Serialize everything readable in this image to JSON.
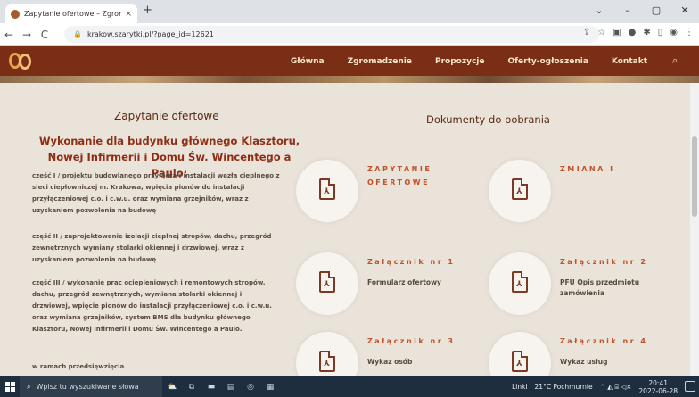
{
  "browser": {
    "tab_title": "Zapytanie ofertowe – Zgromadz",
    "tab_close": "×",
    "new_tab": "+",
    "url": "krakow.szarytki.pl/?page_id=12621",
    "window_controls": [
      "⌄",
      "–",
      "▢",
      "✕"
    ],
    "nav": {
      "back": "←",
      "forward": "→",
      "reload": "C"
    },
    "toolbar_icons": [
      "share-icon",
      "star-icon",
      "extension-icon",
      "profile-icon",
      "puzzle-icon",
      "sidebar-icon",
      "account-icon",
      "menu-icon"
    ]
  },
  "site": {
    "menu": [
      "Główna",
      "Zgromadzenie",
      "Propozycje",
      "Oferty-ogłoszenia",
      "Kontakt"
    ]
  },
  "left": {
    "title": "Zapytanie ofertowe",
    "subtitle": "Wykonanie dla budynku głównego Klasztoru, Nowej Infirmerii i Domu Św. Wincentego a Paulo:",
    "paragraphs": [
      "cześć I / projektu budowlanego przyłącza i instalacji węzła cieplnego z sieci ciepłowniczej m. Krakowa, wpięcia pionów do instalacji przyłączeniowej c.o. i c.w.u. oraz wymiana grzejników, wraz z uzyskaniem pozwolenia na budowę",
      "część II / zaprojektowanie izolacji cieplnej stropów, dachu, przegród zewnętrznych wymiany stolarki okiennej i drzwiowej, wraz z uzyskaniem pozwolenia na budowę",
      "część III / wykonanie prac ociepleniowych i remontowych stropów, dachu, przegród zewnętrznych, wymiana stolarki okiennej i drzwiowej, wpięcie pionów do instalacji przyłączeniowej c.o. i c.w.u. oraz wymiana grzejników, system BMS dla budynku głównego Klasztoru, Nowej Infirmerii i Domu Św. Wincentego a Paulo.",
      "w ramach przedsięwzięcia"
    ]
  },
  "right": {
    "title": "Dokumenty do pobrania",
    "docs": [
      {
        "title": "ZAPYTANIE OFERTOWE",
        "desc": ""
      },
      {
        "title": "ZMIANA I",
        "desc": ""
      },
      {
        "title": "Załącznik nr 1",
        "desc": "Formularz ofertowy"
      },
      {
        "title": "Załącznik nr 2",
        "desc": "PFU Opis przedmiotu zamówienia"
      },
      {
        "title": "Załącznik nr 3",
        "desc": "Wykaz osób"
      },
      {
        "title": "Załącznik nr 4",
        "desc": "Wykaz usług"
      }
    ]
  },
  "taskbar": {
    "search_placeholder": "Wpisz tu wyszukiwane słowa",
    "links": "Linki",
    "weather": "21°C  Pochmurnie",
    "time": "20:41",
    "date": "2022-06-28"
  },
  "colors": {
    "header": "#7a2e15",
    "accent": "#c0522a",
    "background": "#e9e3d9"
  }
}
